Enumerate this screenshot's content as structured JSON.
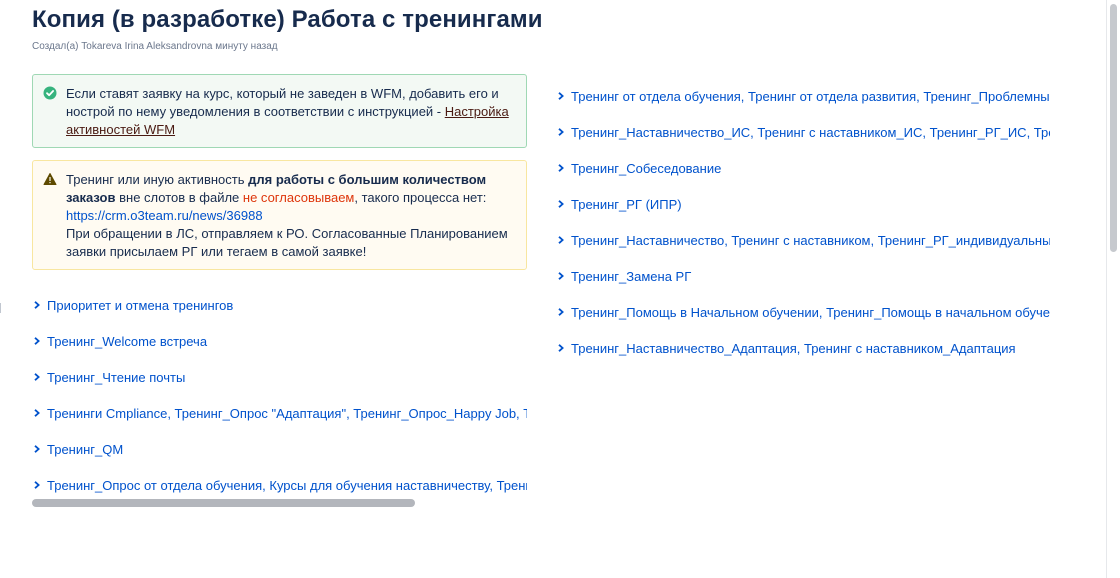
{
  "page": {
    "title": "Копия (в разработке) Работа с тренингами",
    "byline": "Создал(а) Tokareva Irina Aleksandrovna минуту назад"
  },
  "success_panel": {
    "icon": "check-circle-icon",
    "color": "#36b37e",
    "text": "Если ставят заявку на курс, который не заведен в WFM, добавить его и нострой по нему уведомления в соответствии с инструкцией - ",
    "link_text": "Настройка активностей WFM"
  },
  "warning_panel": {
    "icon": "warning-icon",
    "color": "#172b4d",
    "text_1": "Тренинг или иную активность ",
    "bold_text": "для работы с большим количеством заказов",
    "text_2": " вне слотов в файле ",
    "red_text": "не согласовываем",
    "text_3": ", такого процесса нет:",
    "link_text": "https://crm.o3team.ru/news/36988",
    "text_4": "При обращении в ЛС, отправляем к РО. Согласованные Планированием заявки присылаем РГ или тегаем в самой заявке!"
  },
  "left_expands": [
    {
      "label": "Приоритет и отмена тренингов"
    },
    {
      "label": "Тренинг_Welcome встреча"
    },
    {
      "label": "Тренинг_Чтение почты"
    },
    {
      "label": "Тренинги Cmpliance, Тренинг_Опрос \"Адаптация\", Тренинг_Опрос_Happy Job, Тренинг"
    },
    {
      "label": "Тренинг_QM"
    },
    {
      "label": "Тренинг_Опрос от отдела обучения, Курсы для обучения наставничеству, Тренинг_"
    }
  ],
  "right_expands": [
    {
      "label": "Тренинг от отдела обучения, Тренинг от отдела развития, Тренинг_Проблемные зоны"
    },
    {
      "label": "Тренинг_Наставничество_ИС, Тренинг с наставником_ИС, Тренинг_РГ_ИС, Тренинг_"
    },
    {
      "label": "Тренинг_Собеседование"
    },
    {
      "label": "Тренинг_РГ (ИПР)"
    },
    {
      "label": "Тренинг_Наставничество, Тренинг с наставником, Тренинг_РГ_индивидуальный, Тре"
    },
    {
      "label": "Тренинг_Замена РГ"
    },
    {
      "label": "Тренинг_Помощь в Начальном обучении, Тренинг_Помощь в начальном обучении"
    },
    {
      "label": "Тренинг_Наставничество_Адаптация, Тренинг с наставником_Адаптация"
    }
  ],
  "colors": {
    "link": "#0052cc",
    "title": "#172b4d",
    "success_border": "#9fd8b4",
    "warning_border": "#f8e6a0"
  }
}
